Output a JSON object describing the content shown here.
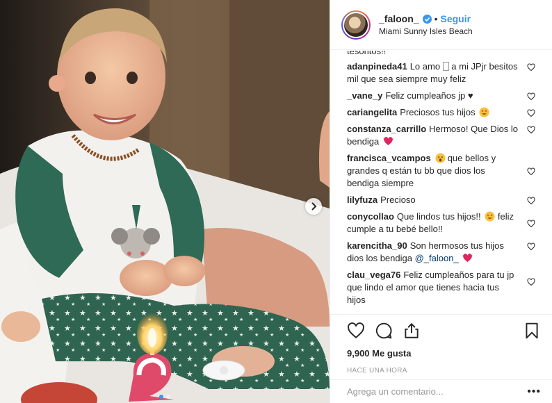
{
  "post": {
    "username": "_faloon_",
    "follow_label": "Seguir",
    "separator": "•",
    "location": "Miami Sunny Isles Beach"
  },
  "comments": {
    "cutoff_text": "tesoritos!!",
    "items": [
      {
        "user": "adanpineda41",
        "text": "Lo amo ",
        "tail": " a mi JPjr besitos mil que sea siempre muy feliz",
        "emoji": "hug-emoji"
      },
      {
        "user": "_vane_y",
        "text": "Feliz cumpleaños jp ♥"
      },
      {
        "user": "cariangelita",
        "text": "Preciosos tus hijos",
        "emoji": "heart-eyes-emoji"
      },
      {
        "user": "constanza_carrillo",
        "text": "Hermoso! Que Dios lo bendiga",
        "emoji": "beating-heart-emoji"
      },
      {
        "user": "francisca_vcampos",
        "text": "que bellos y grandes q están tu bb que dios los bendiga siempre",
        "emoji_before": "open-mouth-emoji"
      },
      {
        "user": "lilyfuza",
        "text": "Precioso"
      },
      {
        "user": "conycollao",
        "text": "Que lindos tus hijos!!",
        "tail": " feliz cumple a tu bebé bello!!",
        "emoji": "heart-eyes-emoji"
      },
      {
        "user": "karencitha_90",
        "text": "Son hermosos tus hijos dios los bendiga ",
        "mention": "@_faloon_",
        "emoji": "beating-heart-emoji"
      },
      {
        "user": "clau_vega76",
        "text": "Feliz cumpleaños para tu jp que lindo el amor que tienes hacia tus hijos"
      }
    ]
  },
  "actions": {
    "likes": "9,900 Me gusta",
    "time_ago": "HACE UNA HORA"
  },
  "add_comment": {
    "placeholder": "Agrega un comentario...",
    "more": "•••"
  },
  "colors": {
    "link_blue": "#3897f0",
    "text": "#262626",
    "muted": "#999999",
    "divider": "#efefef",
    "active_dot": "#3897f0"
  },
  "icons": [
    "verified-badge-icon",
    "heart-icon",
    "comment-icon",
    "share-icon",
    "bookmark-icon",
    "chevron-right-icon"
  ]
}
